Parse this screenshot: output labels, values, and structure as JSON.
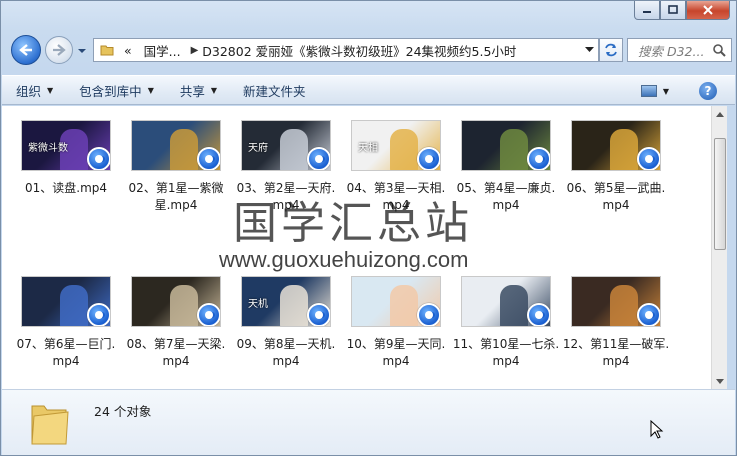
{
  "address": {
    "chevrons": "«",
    "crumb1": "国学...",
    "crumb2": "D32802 爱丽娅《紫微斗数初级班》24集视频约5.5小时"
  },
  "search": {
    "placeholder": "搜索 D32..."
  },
  "toolbar": {
    "organize": "组织",
    "include_library": "包含到库中",
    "share": "共享",
    "new_folder": "新建文件夹"
  },
  "files": [
    {
      "name": "01、读盘.mp4",
      "thumb_bg": "#1b1740",
      "thumb_accent": "#6b3fb5",
      "thumb_text": "紫微斗数"
    },
    {
      "name": "02、第1星—紫微星.mp4",
      "thumb_bg": "#2b4d7a",
      "thumb_accent": "#c99a3a",
      "thumb_text": ""
    },
    {
      "name": "03、第2星—天府.mp4",
      "thumb_bg": "#242b36",
      "thumb_accent": "#c7ccd6",
      "thumb_text": "天府"
    },
    {
      "name": "04、第3星—天相.mp4",
      "thumb_bg": "#f1f1f1",
      "thumb_accent": "#e4b34a",
      "thumb_text": "天相"
    },
    {
      "name": "05、第4星—廉贞.mp4",
      "thumb_bg": "#1d2430",
      "thumb_accent": "#6e8a3f",
      "thumb_text": ""
    },
    {
      "name": "06、第5星—武曲.mp4",
      "thumb_bg": "#2a2418",
      "thumb_accent": "#d9a63a",
      "thumb_text": ""
    },
    {
      "name": "07、第6星—巨门.mp4",
      "thumb_bg": "#1c2946",
      "thumb_accent": "#3f6bc4",
      "thumb_text": ""
    },
    {
      "name": "08、第7星—天梁.mp4",
      "thumb_bg": "#2c2820",
      "thumb_accent": "#c8b89a",
      "thumb_text": ""
    },
    {
      "name": "09、第8星—天机.mp4",
      "thumb_bg": "#1f3a63",
      "thumb_accent": "#e9e2d6",
      "thumb_text": "天机"
    },
    {
      "name": "10、第9星—天同.mp4",
      "thumb_bg": "#d9e8f2",
      "thumb_accent": "#f2c9a8",
      "thumb_text": ""
    },
    {
      "name": "11、第10星—七杀.mp4",
      "thumb_bg": "#e9edf2",
      "thumb_accent": "#3a4b63",
      "thumb_text": ""
    },
    {
      "name": "12、第11星—破军.mp4",
      "thumb_bg": "#3a2a22",
      "thumb_accent": "#c9843a",
      "thumb_text": ""
    }
  ],
  "watermark": {
    "title": "国学汇总站",
    "url": "www.guoxuehuizong.com"
  },
  "details": {
    "count": "24 个对象"
  }
}
